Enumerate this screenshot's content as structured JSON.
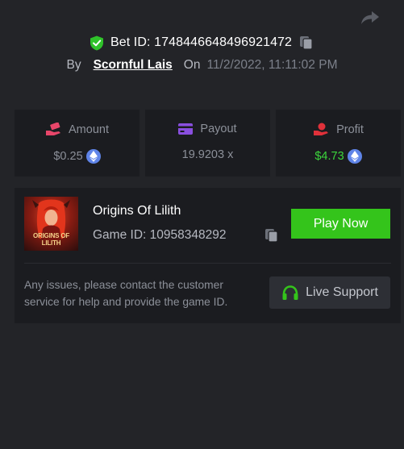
{
  "header": {
    "bet_label": "Bet ID: 1748446648496921472",
    "by_label": "By",
    "username": "Scornful Lais",
    "on_label": "On",
    "date": "11/2/2022, 11:11:02 PM"
  },
  "stats": {
    "amount": {
      "label": "Amount",
      "value": "$0.25",
      "icon": "money-hand-icon"
    },
    "payout": {
      "label": "Payout",
      "value": "19.9203 x",
      "icon": "card-icon"
    },
    "profit": {
      "label": "Profit",
      "value": "$4.73",
      "icon": "profit-hand-icon"
    }
  },
  "game": {
    "name": "Origins Of Lilith",
    "id_label": "Game ID: 10958348292",
    "thumbnail_caption": "ORIGINS OF LILITH",
    "play_label": "Play Now"
  },
  "support": {
    "text": "Any issues, please contact the customer service for help and provide the game ID.",
    "button_label": "Live Support"
  },
  "colors": {
    "background": "#232428",
    "card": "#1b1c20",
    "accent_green": "#34c41b",
    "profit_green": "#3cd63c",
    "eth_blue": "#5f84e8"
  }
}
